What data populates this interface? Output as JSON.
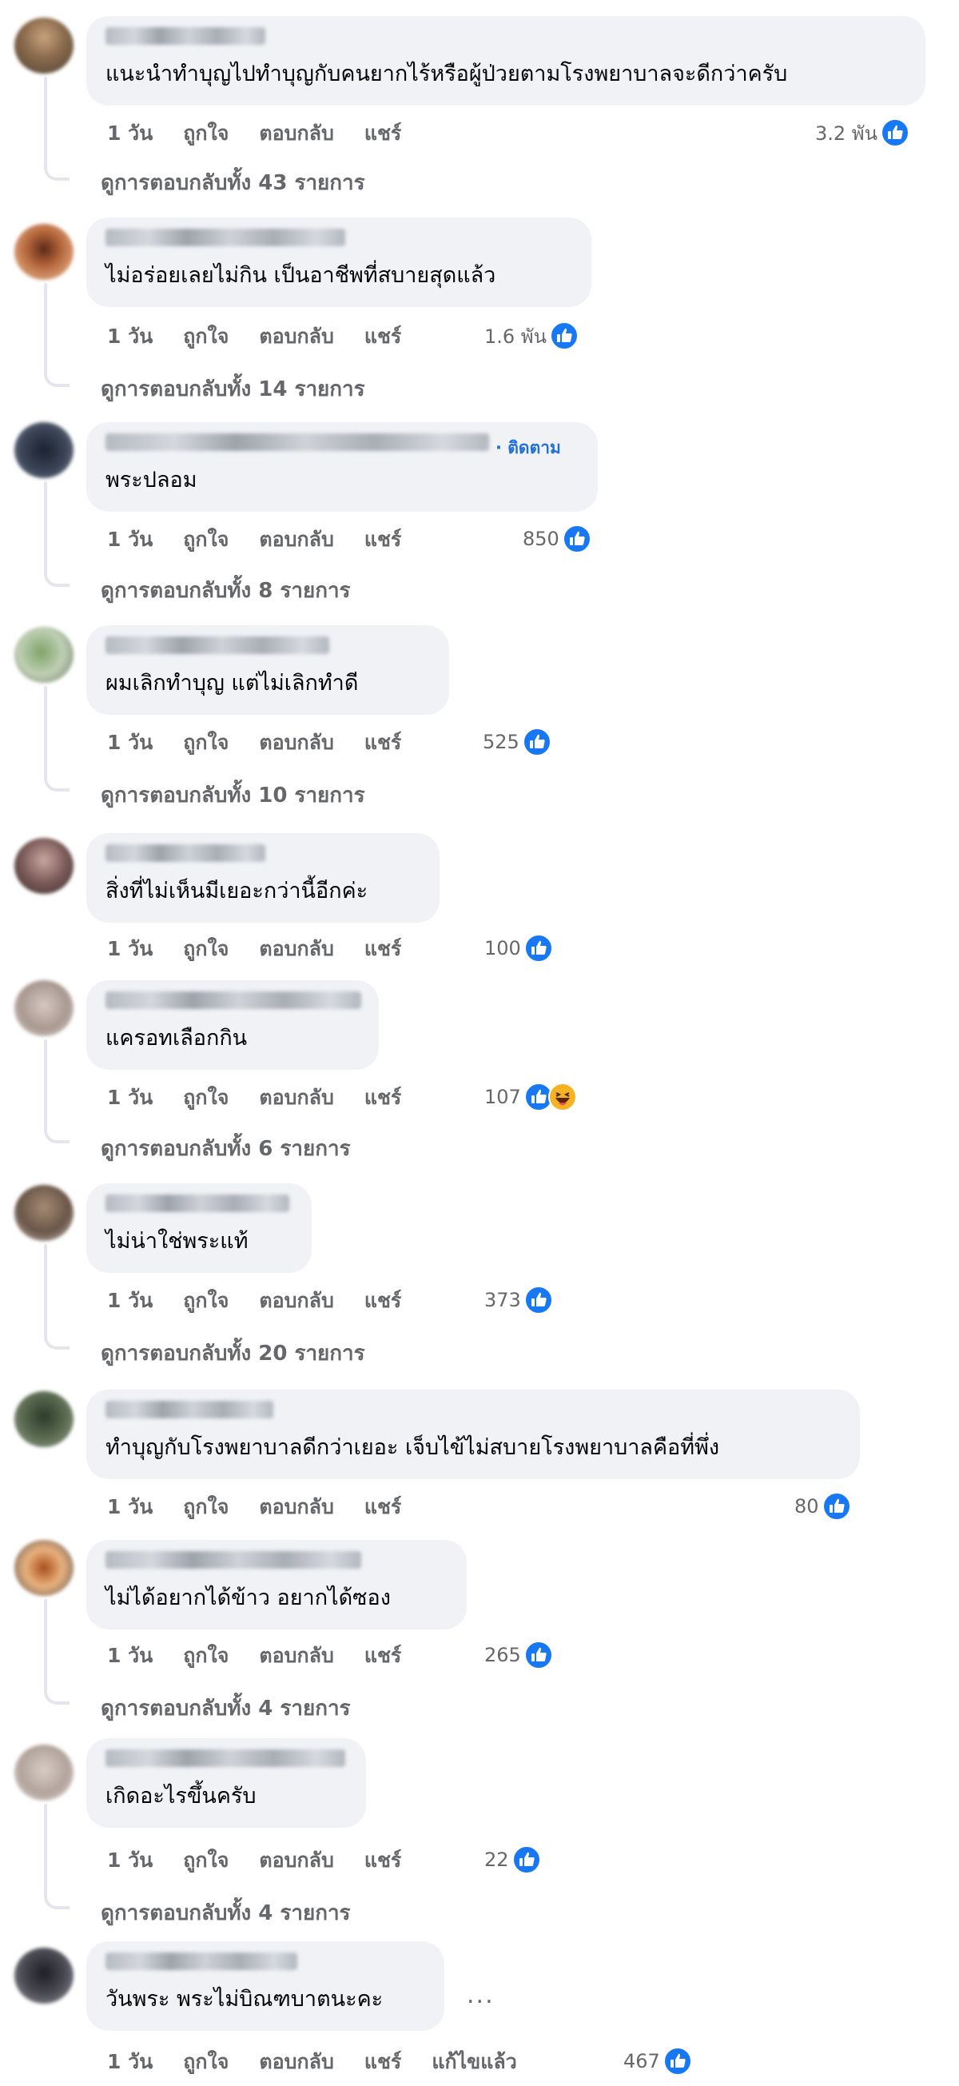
{
  "actions": {
    "time": "1 วัน",
    "like": "ถูกใจ",
    "reply": "ตอบกลับ",
    "share": "แชร์",
    "edited": "แก้ไขแล้ว"
  },
  "follow_label": "· ติดตาม",
  "more_label": "...",
  "comments": [
    {
      "text": "แนะนำทำบุญไปทำบุญกับคนยากไร้หรือผู้ป่วยตามโรงพยาบาลจะดีกว่าครับ",
      "reactions": "3.2 พัน",
      "replies": "ดูการตอบกลับทั้ง 43 รายการ"
    },
    {
      "text": "ไม่อร่อยเลยไม่กิน เป็นอาชีพที่สบายสุดแล้ว",
      "reactions": "1.6 พัน",
      "replies": "ดูการตอบกลับทั้ง 14 รายการ"
    },
    {
      "text": "พระปลอม",
      "reactions": "850",
      "replies": "ดูการตอบกลับทั้ง 8 รายการ"
    },
    {
      "text": "ผมเลิกทำบุญ แต่ไม่เลิกทำดี",
      "reactions": "525",
      "replies": "ดูการตอบกลับทั้ง 10 รายการ"
    },
    {
      "text": "สิ่งที่ไม่เห็นมีเยอะกว่านี้อีกค่ะ",
      "reactions": "100"
    },
    {
      "text": "แครอทเลือกกิน",
      "reactions": "107",
      "replies": "ดูการตอบกลับทั้ง 6 รายการ"
    },
    {
      "text": "ไม่น่าใช่พระแท้",
      "reactions": "373",
      "replies": "ดูการตอบกลับทั้ง 20 รายการ"
    },
    {
      "text": "ทำบุญกับโรงพยาบาลดีกว่าเยอะ เจ็บไข้ไม่สบายโรงพยาบาลคือที่พึ่ง",
      "reactions": "80"
    },
    {
      "text": "ไม่ได้อยากได้ข้าว อยากได้ซอง",
      "reactions": "265",
      "replies": "ดูการตอบกลับทั้ง 4 รายการ"
    },
    {
      "text": "เกิดอะไรขึ้นครับ",
      "reactions": "22",
      "replies": "ดูการตอบกลับทั้ง 4 รายการ"
    },
    {
      "text": "วันพระ พระไม่บิณฑบาตนะคะ",
      "reactions": "467"
    }
  ],
  "colors": {
    "bubble": "#f0f2f5",
    "secondary_text": "#65676b",
    "link_blue": "#216fdb",
    "like_blue": "#1877f2",
    "thread_line": "#e4e6eb"
  },
  "icons": [
    "like-icon",
    "haha-icon",
    "more-options-icon"
  ]
}
